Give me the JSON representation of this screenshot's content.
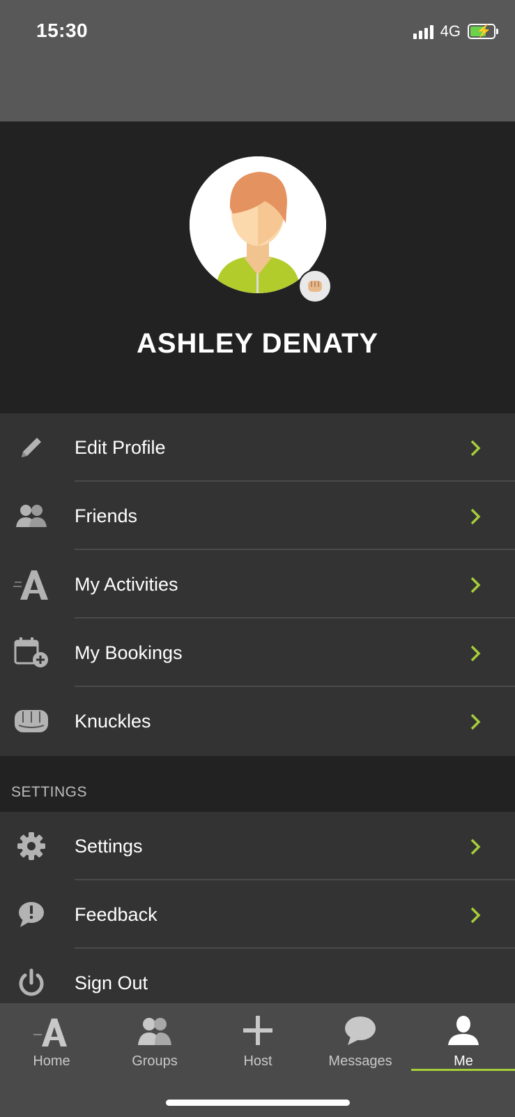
{
  "status": {
    "time": "15:30",
    "network": "4G"
  },
  "profile": {
    "name": "ASHLEY DENATY"
  },
  "menu": {
    "items": [
      {
        "label": "Edit Profile",
        "icon": "pencil-icon"
      },
      {
        "label": "Friends",
        "icon": "friends-icon"
      },
      {
        "label": "My Activities",
        "icon": "activities-icon"
      },
      {
        "label": "My Bookings",
        "icon": "calendar-add-icon"
      },
      {
        "label": "Knuckles",
        "icon": "fist-icon"
      }
    ]
  },
  "settings_section": {
    "header": "SETTINGS",
    "items": [
      {
        "label": "Settings",
        "icon": "gear-icon"
      },
      {
        "label": "Feedback",
        "icon": "feedback-icon"
      },
      {
        "label": "Sign Out",
        "icon": "power-icon"
      }
    ]
  },
  "tabs": [
    {
      "label": "Home",
      "icon": "home-a-icon"
    },
    {
      "label": "Groups",
      "icon": "groups-icon"
    },
    {
      "label": "Host",
      "icon": "plus-icon"
    },
    {
      "label": "Messages",
      "icon": "chat-bubble-icon"
    },
    {
      "label": "Me",
      "icon": "person-icon",
      "active": true
    }
  ],
  "colors": {
    "accent": "#a6ce39",
    "header_bg": "#222222",
    "row_bg": "#333333",
    "status_bg": "#585858",
    "icon": "#b3b3b3"
  }
}
